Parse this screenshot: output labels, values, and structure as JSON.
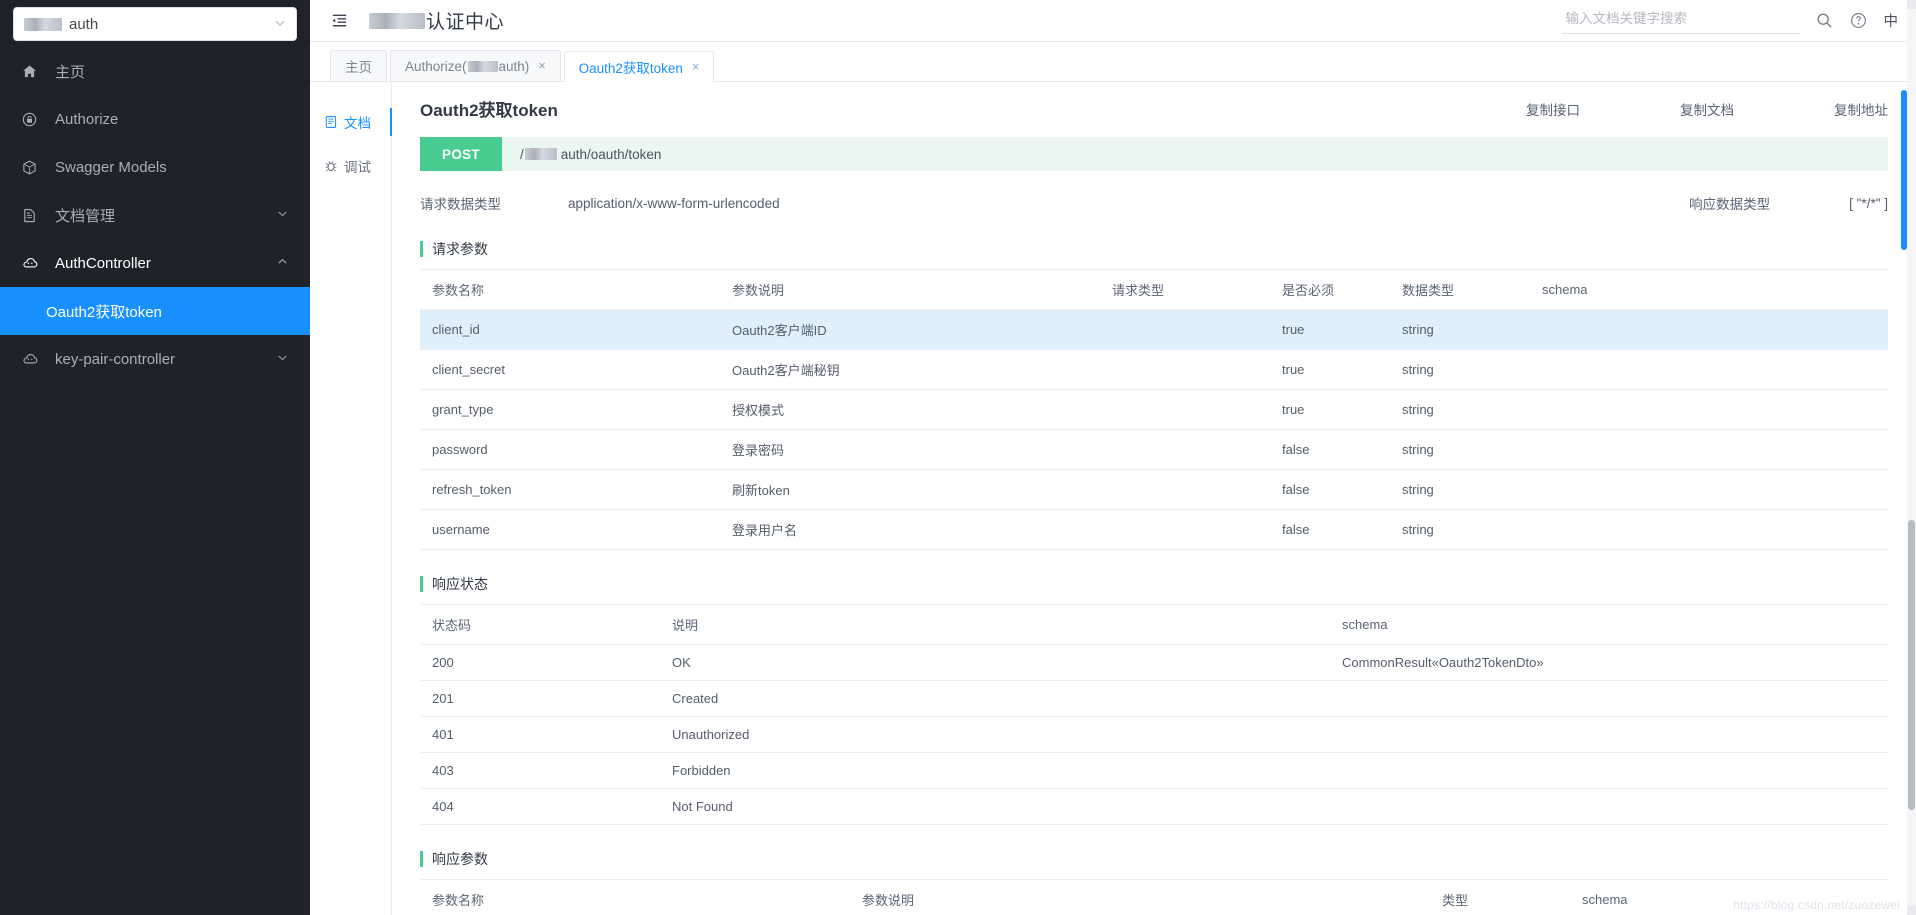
{
  "sidebar": {
    "project_select": {
      "label": "auth",
      "redacted_prefix": true,
      "caret": "chevron-down"
    },
    "items": [
      {
        "label": "主页",
        "icon": "home-icon",
        "has_arrow": false,
        "light": false
      },
      {
        "label": "Authorize",
        "icon": "lock-icon",
        "has_arrow": false,
        "light": false
      },
      {
        "label": "Swagger Models",
        "icon": "cube-icon",
        "has_arrow": false,
        "light": false
      },
      {
        "label": "文档管理",
        "icon": "document-icon",
        "has_arrow": true,
        "arrow": "chevron-down",
        "light": false
      },
      {
        "label": "AuthController",
        "icon": "cloud-icon",
        "has_arrow": true,
        "arrow": "chevron-up",
        "light": true
      }
    ],
    "sub_item": {
      "label": "Oauth2获取token",
      "active": true
    },
    "tail_item": {
      "label": "key-pair-controller",
      "icon": "cloud-icon",
      "has_arrow": true,
      "arrow": "chevron-down"
    }
  },
  "topbar": {
    "collapse_icon": "menu-fold-icon",
    "app_title": "认证中心",
    "search_placeholder": "输入文档关键字搜索",
    "search_value": "",
    "search_icon": "search-icon",
    "help_icon": "question-circle-icon",
    "lang_label": "中"
  },
  "tabs": [
    {
      "label": "主页",
      "closable": false,
      "active": false
    },
    {
      "label": "Authorize(",
      "suffix": "auth)",
      "redacted": true,
      "closable": true,
      "active": false,
      "close_label": "×"
    },
    {
      "label": "Oauth2获取token",
      "closable": true,
      "active": true,
      "close_label": "×"
    }
  ],
  "doc_side": [
    {
      "label": "文档",
      "icon": "book-icon",
      "active": true
    },
    {
      "label": "调试",
      "icon": "bug-icon",
      "active": false
    }
  ],
  "doc": {
    "title": "Oauth2获取token",
    "actions": [
      {
        "label": "复制接口"
      },
      {
        "label": "复制文档"
      },
      {
        "label": "复制地址"
      }
    ],
    "method": "POST",
    "path": "auth/oauth/token",
    "path_prefix": "/",
    "request_type_label": "请求数据类型",
    "request_type_value": "application/x-www-form-urlencoded",
    "response_type_label": "响应数据类型",
    "response_type_value": "[ \"*/*\" ]"
  },
  "request_params": {
    "section_title": "请求参数",
    "headers": [
      "参数名称",
      "参数说明",
      "请求类型",
      "是否必须",
      "数据类型",
      "schema"
    ],
    "rows": [
      {
        "name": "client_id",
        "desc": "Oauth2客户端ID",
        "in": "",
        "required": "true",
        "type": "string",
        "schema": "",
        "highlight": true
      },
      {
        "name": "client_secret",
        "desc": "Oauth2客户端秘钥",
        "in": "",
        "required": "true",
        "type": "string",
        "schema": "",
        "highlight": false
      },
      {
        "name": "grant_type",
        "desc": "授权模式",
        "in": "",
        "required": "true",
        "type": "string",
        "schema": "",
        "highlight": false
      },
      {
        "name": "password",
        "desc": "登录密码",
        "in": "",
        "required": "false",
        "type": "string",
        "schema": "",
        "highlight": false
      },
      {
        "name": "refresh_token",
        "desc": "刷新token",
        "in": "",
        "required": "false",
        "type": "string",
        "schema": "",
        "highlight": false
      },
      {
        "name": "username",
        "desc": "登录用户名",
        "in": "",
        "required": "false",
        "type": "string",
        "schema": "",
        "highlight": false
      }
    ]
  },
  "response_status": {
    "section_title": "响应状态",
    "headers": [
      "状态码",
      "说明",
      "schema"
    ],
    "rows": [
      {
        "code": "200",
        "desc": "OK",
        "schema": "CommonResult«Oauth2TokenDto»"
      },
      {
        "code": "201",
        "desc": "Created",
        "schema": ""
      },
      {
        "code": "401",
        "desc": "Unauthorized",
        "schema": ""
      },
      {
        "code": "403",
        "desc": "Forbidden",
        "schema": ""
      },
      {
        "code": "404",
        "desc": "Not Found",
        "schema": ""
      }
    ]
  },
  "response_params": {
    "section_title": "响应参数",
    "headers": [
      "参数名称",
      "参数说明",
      "类型",
      "schema"
    ],
    "rows": []
  },
  "watermark": "https://blog.csdn.net/zuozewei",
  "colors": {
    "sidebar_bg": "#20222a",
    "active_blue": "#1890ff",
    "method_green": "#49cc90",
    "required_red": "#f5222d",
    "row_highlight": "#dff0fa"
  }
}
